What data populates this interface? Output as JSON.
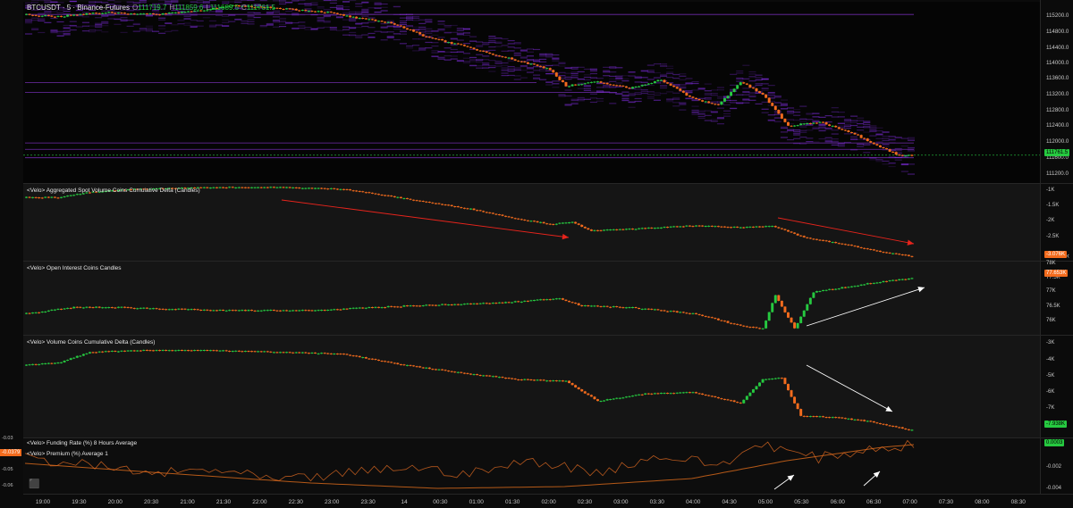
{
  "header": {
    "symbol": "BTCUSDT · 5 · Binance-Futures",
    "o_label": "O",
    "o_value": "111719.7",
    "h_label": "H",
    "h_value": "111859.6",
    "l_label": "L",
    "l_value": "111689.5",
    "c_label": "C",
    "c_value": "111761.5"
  },
  "panes": [
    {
      "title": "",
      "axis": [
        "115200.0",
        "114800.0",
        "114400.0",
        "114000.0",
        "113600.0",
        "113200.0",
        "112800.0",
        "112400.0",
        "112000.0",
        "111600.0",
        "111200.0"
      ],
      "last_tag": "111761.5"
    },
    {
      "title": "<Velo> Aggregated Spot Volume Coins Cumulative Delta (Candles)",
      "axis": [
        "-1K",
        "-1.5K",
        "-2K",
        "-2.5K"
      ],
      "last_tag": "-3.076K"
    },
    {
      "title": "<Velo> Open Interest Coins Candles",
      "axis": [
        "78K",
        "77.5K",
        "77K",
        "76.5K",
        "76K"
      ],
      "last_tag": "77.653K"
    },
    {
      "title": "<Velo> Volume Coins Cumulative Delta (Candles)",
      "axis": [
        "-3K",
        "-4K",
        "-5K",
        "-6K",
        "-7K"
      ],
      "last_tag": "-7.938K"
    },
    {
      "title": "<Velo> Funding Rate (%) 8 Hours Average",
      "title2": "<Velo> Premium (%) Average 1",
      "axis": [
        "-0.002",
        "-0.004"
      ],
      "last_tag": "0.0003"
    }
  ],
  "left_axis": {
    "labels": [
      "-0.03",
      "-0.05",
      "-0.06"
    ],
    "tag": "-0.0379"
  },
  "time_axis": [
    "19:00",
    "19:30",
    "20:00",
    "20:30",
    "21:00",
    "21:30",
    "22:00",
    "22:30",
    "23:00",
    "23:30",
    "14",
    "00:30",
    "01:00",
    "01:30",
    "02:00",
    "02:30",
    "03:00",
    "03:30",
    "04:00",
    "04:30",
    "05:00",
    "05:30",
    "06:00",
    "06:30",
    "07:00",
    "07:30",
    "08:00",
    "08:30"
  ],
  "colors": {
    "up": "#26c940",
    "down": "#f26b1d",
    "bg": "#0b0b0b",
    "pane_bg": "#151515",
    "heat": "#7a2bd4",
    "red_arrow": "#e8241c",
    "white_arrow": "#ffffff"
  },
  "chart_data": [
    {
      "type": "candlestick",
      "title": "BTCUSDT · 5 · Binance-Futures",
      "ylim": [
        111100,
        115400
      ],
      "anchors": [
        [
          0,
          115100
        ],
        [
          10,
          115050
        ],
        [
          25,
          115150
        ],
        [
          40,
          115100
        ],
        [
          55,
          115200
        ],
        [
          65,
          115300
        ],
        [
          80,
          115250
        ],
        [
          95,
          115150
        ],
        [
          105,
          115000
        ],
        [
          115,
          114900
        ],
        [
          125,
          114600
        ],
        [
          140,
          114300
        ],
        [
          155,
          114000
        ],
        [
          165,
          113800
        ],
        [
          170,
          113400
        ],
        [
          180,
          113500
        ],
        [
          190,
          113350
        ],
        [
          200,
          113550
        ],
        [
          210,
          113100
        ],
        [
          218,
          112950
        ],
        [
          225,
          113500
        ],
        [
          232,
          113200
        ],
        [
          240,
          112450
        ],
        [
          250,
          112550
        ],
        [
          260,
          112300
        ],
        [
          268,
          112000
        ],
        [
          275,
          111750
        ],
        [
          280,
          111761.5
        ]
      ]
    },
    {
      "type": "candlestick",
      "title": "<Velo> Aggregated Spot Volume Coins Cumulative Delta (Candles)",
      "ylim": [
        -3200,
        -900
      ],
      "anchors": [
        [
          0,
          -1300
        ],
        [
          10,
          -1300
        ],
        [
          20,
          -1150
        ],
        [
          35,
          -1050
        ],
        [
          60,
          -1000
        ],
        [
          80,
          -1000
        ],
        [
          100,
          -1050
        ],
        [
          120,
          -1350
        ],
        [
          140,
          -1650
        ],
        [
          155,
          -1950
        ],
        [
          165,
          -2100
        ],
        [
          172,
          -2050
        ],
        [
          178,
          -2300
        ],
        [
          190,
          -2250
        ],
        [
          210,
          -2150
        ],
        [
          225,
          -2200
        ],
        [
          235,
          -2150
        ],
        [
          245,
          -2500
        ],
        [
          260,
          -2750
        ],
        [
          270,
          -2950
        ],
        [
          280,
          -3076
        ]
      ]
    },
    {
      "type": "candlestick",
      "title": "<Velo> Open Interest Coins Candles",
      "ylim": [
        75800,
        78200
      ],
      "anchors": [
        [
          0,
          76500
        ],
        [
          15,
          76700
        ],
        [
          30,
          76700
        ],
        [
          60,
          76600
        ],
        [
          90,
          76600
        ],
        [
          120,
          76750
        ],
        [
          150,
          76850
        ],
        [
          168,
          77000
        ],
        [
          175,
          76750
        ],
        [
          190,
          76700
        ],
        [
          210,
          76500
        ],
        [
          225,
          76100
        ],
        [
          232,
          76000
        ],
        [
          236,
          77100
        ],
        [
          242,
          76000
        ],
        [
          248,
          77200
        ],
        [
          260,
          77400
        ],
        [
          270,
          77550
        ],
        [
          280,
          77653
        ]
      ]
    },
    {
      "type": "candlestick",
      "title": "<Velo> Volume Coins Cumulative Delta (Candles)",
      "ylim": [
        -8300,
        -2700
      ],
      "anchors": [
        [
          0,
          -4300
        ],
        [
          10,
          -4200
        ],
        [
          20,
          -3600
        ],
        [
          35,
          -3500
        ],
        [
          60,
          -3500
        ],
        [
          80,
          -3600
        ],
        [
          100,
          -3700
        ],
        [
          115,
          -4200
        ],
        [
          135,
          -4700
        ],
        [
          155,
          -5100
        ],
        [
          170,
          -5200
        ],
        [
          180,
          -6300
        ],
        [
          195,
          -5900
        ],
        [
          210,
          -5800
        ],
        [
          225,
          -6400
        ],
        [
          232,
          -5100
        ],
        [
          238,
          -5000
        ],
        [
          244,
          -7100
        ],
        [
          255,
          -7200
        ],
        [
          265,
          -7400
        ],
        [
          280,
          -7938
        ]
      ]
    },
    {
      "type": "line",
      "title": "<Velo> Funding Rate (%) 8 Hours Average",
      "series": [
        {
          "name": "<Velo> Funding Rate (%) 8 Hours Average",
          "anchors": [
            [
              0,
              -0.0018
            ],
            [
              40,
              -0.0028
            ],
            [
              90,
              -0.004
            ],
            [
              130,
              -0.0046
            ],
            [
              170,
              -0.0044
            ],
            [
              210,
              -0.0035
            ],
            [
              240,
              -0.0015
            ],
            [
              270,
              0.0
            ],
            [
              280,
              0.0003
            ]
          ]
        },
        {
          "name": "<Velo> Premium (%) Average 1",
          "anchors": [
            [
              0,
              -0.0012
            ],
            [
              20,
              -0.002
            ],
            [
              40,
              -0.003
            ],
            [
              60,
              -0.0025
            ],
            [
              80,
              -0.0038
            ],
            [
              100,
              -0.003
            ],
            [
              120,
              -0.0022
            ],
            [
              140,
              -0.003
            ],
            [
              160,
              -0.0015
            ],
            [
              180,
              -0.0028
            ],
            [
              200,
              -0.001
            ],
            [
              220,
              -0.002
            ],
            [
              232,
              0.0006
            ],
            [
              240,
              -0.0005
            ],
            [
              250,
              -0.0012
            ],
            [
              260,
              -0.0006
            ],
            [
              270,
              0.0
            ],
            [
              280,
              0.0002
            ]
          ]
        }
      ]
    }
  ]
}
